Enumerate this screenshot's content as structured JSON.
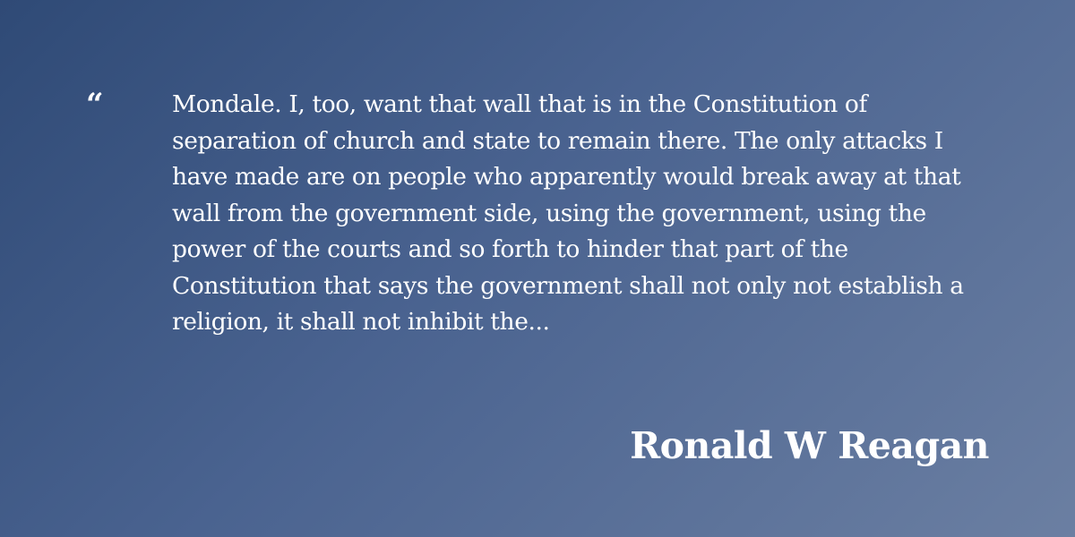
{
  "quote": {
    "mark": "“",
    "text": "Mondale. I, too, want that wall that is in the Constitution of separation of church and state to remain there. The only attacks I have made are on people who apparently would break away at that wall from the government side, using the government, using the power of the courts and so forth to hinder that part of the Constitution that says the government shall not only not establish a religion, it shall not inhibit the...",
    "author": "Ronald W Reagan"
  },
  "colors": {
    "background_start": "#2f4a76",
    "background_end": "#6b7fa2",
    "text": "#ffffff"
  }
}
